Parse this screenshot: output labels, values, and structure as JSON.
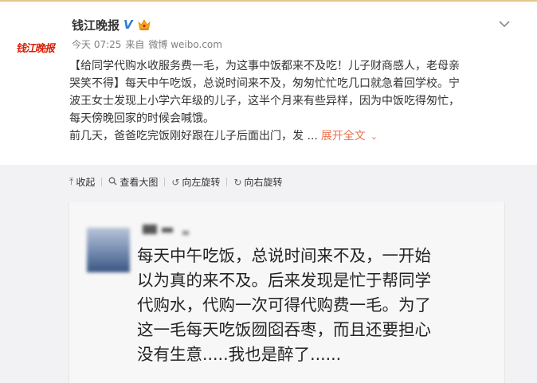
{
  "header": {
    "avatar_text": "钱江晚报",
    "screen_name": "钱江晚报",
    "verified_mark": "V",
    "time": "今天 07:25",
    "source_prefix": "来自",
    "source": "微博 weibo.com"
  },
  "post": {
    "lines": [
      "【给同学代购水收服务费一毛，为这事中饭都来不及吃！儿子财商感人，老母亲",
      "哭笑不得】每天中午吃饭，总说时间来不及，匆匆忙忙吃几口就急着回学校。宁",
      "波王女士发现上小学六年级的儿子，这半个月来有些异样，因为中饭吃得匆忙，",
      "每天傍晚回家的时候会喊饿。",
      "前几天，爸爸吃完饭刚好跟在儿子后面出门，发 ..."
    ],
    "expand_label": "展开全文",
    "expand_chevron": "⌄"
  },
  "toolbar": {
    "collapse": "收起",
    "view_large": "查看大图",
    "rotate_left": "向左旋转",
    "rotate_right": "向右旋转"
  },
  "image": {
    "lines": [
      "每天中午吃饭，总说时间来不及，一开始",
      "以为真的来不及。后来发现是忙于帮同学",
      "代购水，代购一次可得代购费一毛。为了",
      "这一毛每天吃饭囫囵吞枣，而且还要担心",
      "没有生意.....我也是醉了......"
    ]
  },
  "colors": {
    "brand_red": "#d81e06",
    "link_orange": "#eb7350",
    "verified_blue": "#2e7cd6",
    "media_bg": "#f2f2f5"
  }
}
